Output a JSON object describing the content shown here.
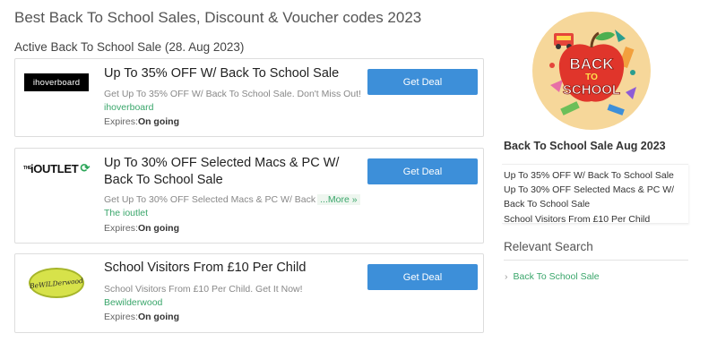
{
  "page": {
    "title": "Best Back To School Sales, Discount & Voucher codes 2023",
    "section_heading": "Active Back To School Sale (28. Aug 2023)"
  },
  "deals": [
    {
      "logo_text": "ihoverboard",
      "title": "Up To 35% OFF W/ Back To School Sale",
      "description": "Get Up To 35% OFF W/ Back To School Sale. Don't Miss Out!",
      "store": "ihoverboard",
      "expires_label": "Expires:",
      "expires_value": "On going",
      "button_label": "Get Deal"
    },
    {
      "logo_text_small": "THE",
      "logo_text": "iOUTLET",
      "title": "Up To 30% OFF Selected Macs & PC W/ Back To School Sale",
      "description": "Get Up To 30% OFF Selected Macs & PC W/ Back",
      "more_label": "...More »",
      "store": "The ioutlet",
      "expires_label": "Expires:",
      "expires_value": "On going",
      "button_label": "Get Deal"
    },
    {
      "logo_text": "BeWILDerwood",
      "title": "School Visitors From £10 Per Child",
      "description": "School Visitors From £10 Per Child. Get It Now!",
      "store": "Bewilderwood",
      "expires_label": "Expires:",
      "expires_value": "On going",
      "button_label": "Get Deal"
    }
  ],
  "sidebar": {
    "promo_image_text": [
      "BACK",
      "TO",
      "SCHOOL"
    ],
    "heading": "Back To School Sale Aug 2023",
    "items": [
      "Up To 35% OFF W/ Back To School Sale",
      "Up To 30% OFF Selected Macs & PC W/",
      "Back To School Sale",
      "School Visitors From £10 Per Child"
    ],
    "relevant_heading": "Relevant Search",
    "relevant_links": [
      {
        "chevron": "›",
        "label": "Back To School Sale"
      }
    ]
  },
  "colors": {
    "button": "#3d8fd9",
    "link_green": "#3aa66b",
    "promo_bg": "#f6d79a"
  }
}
